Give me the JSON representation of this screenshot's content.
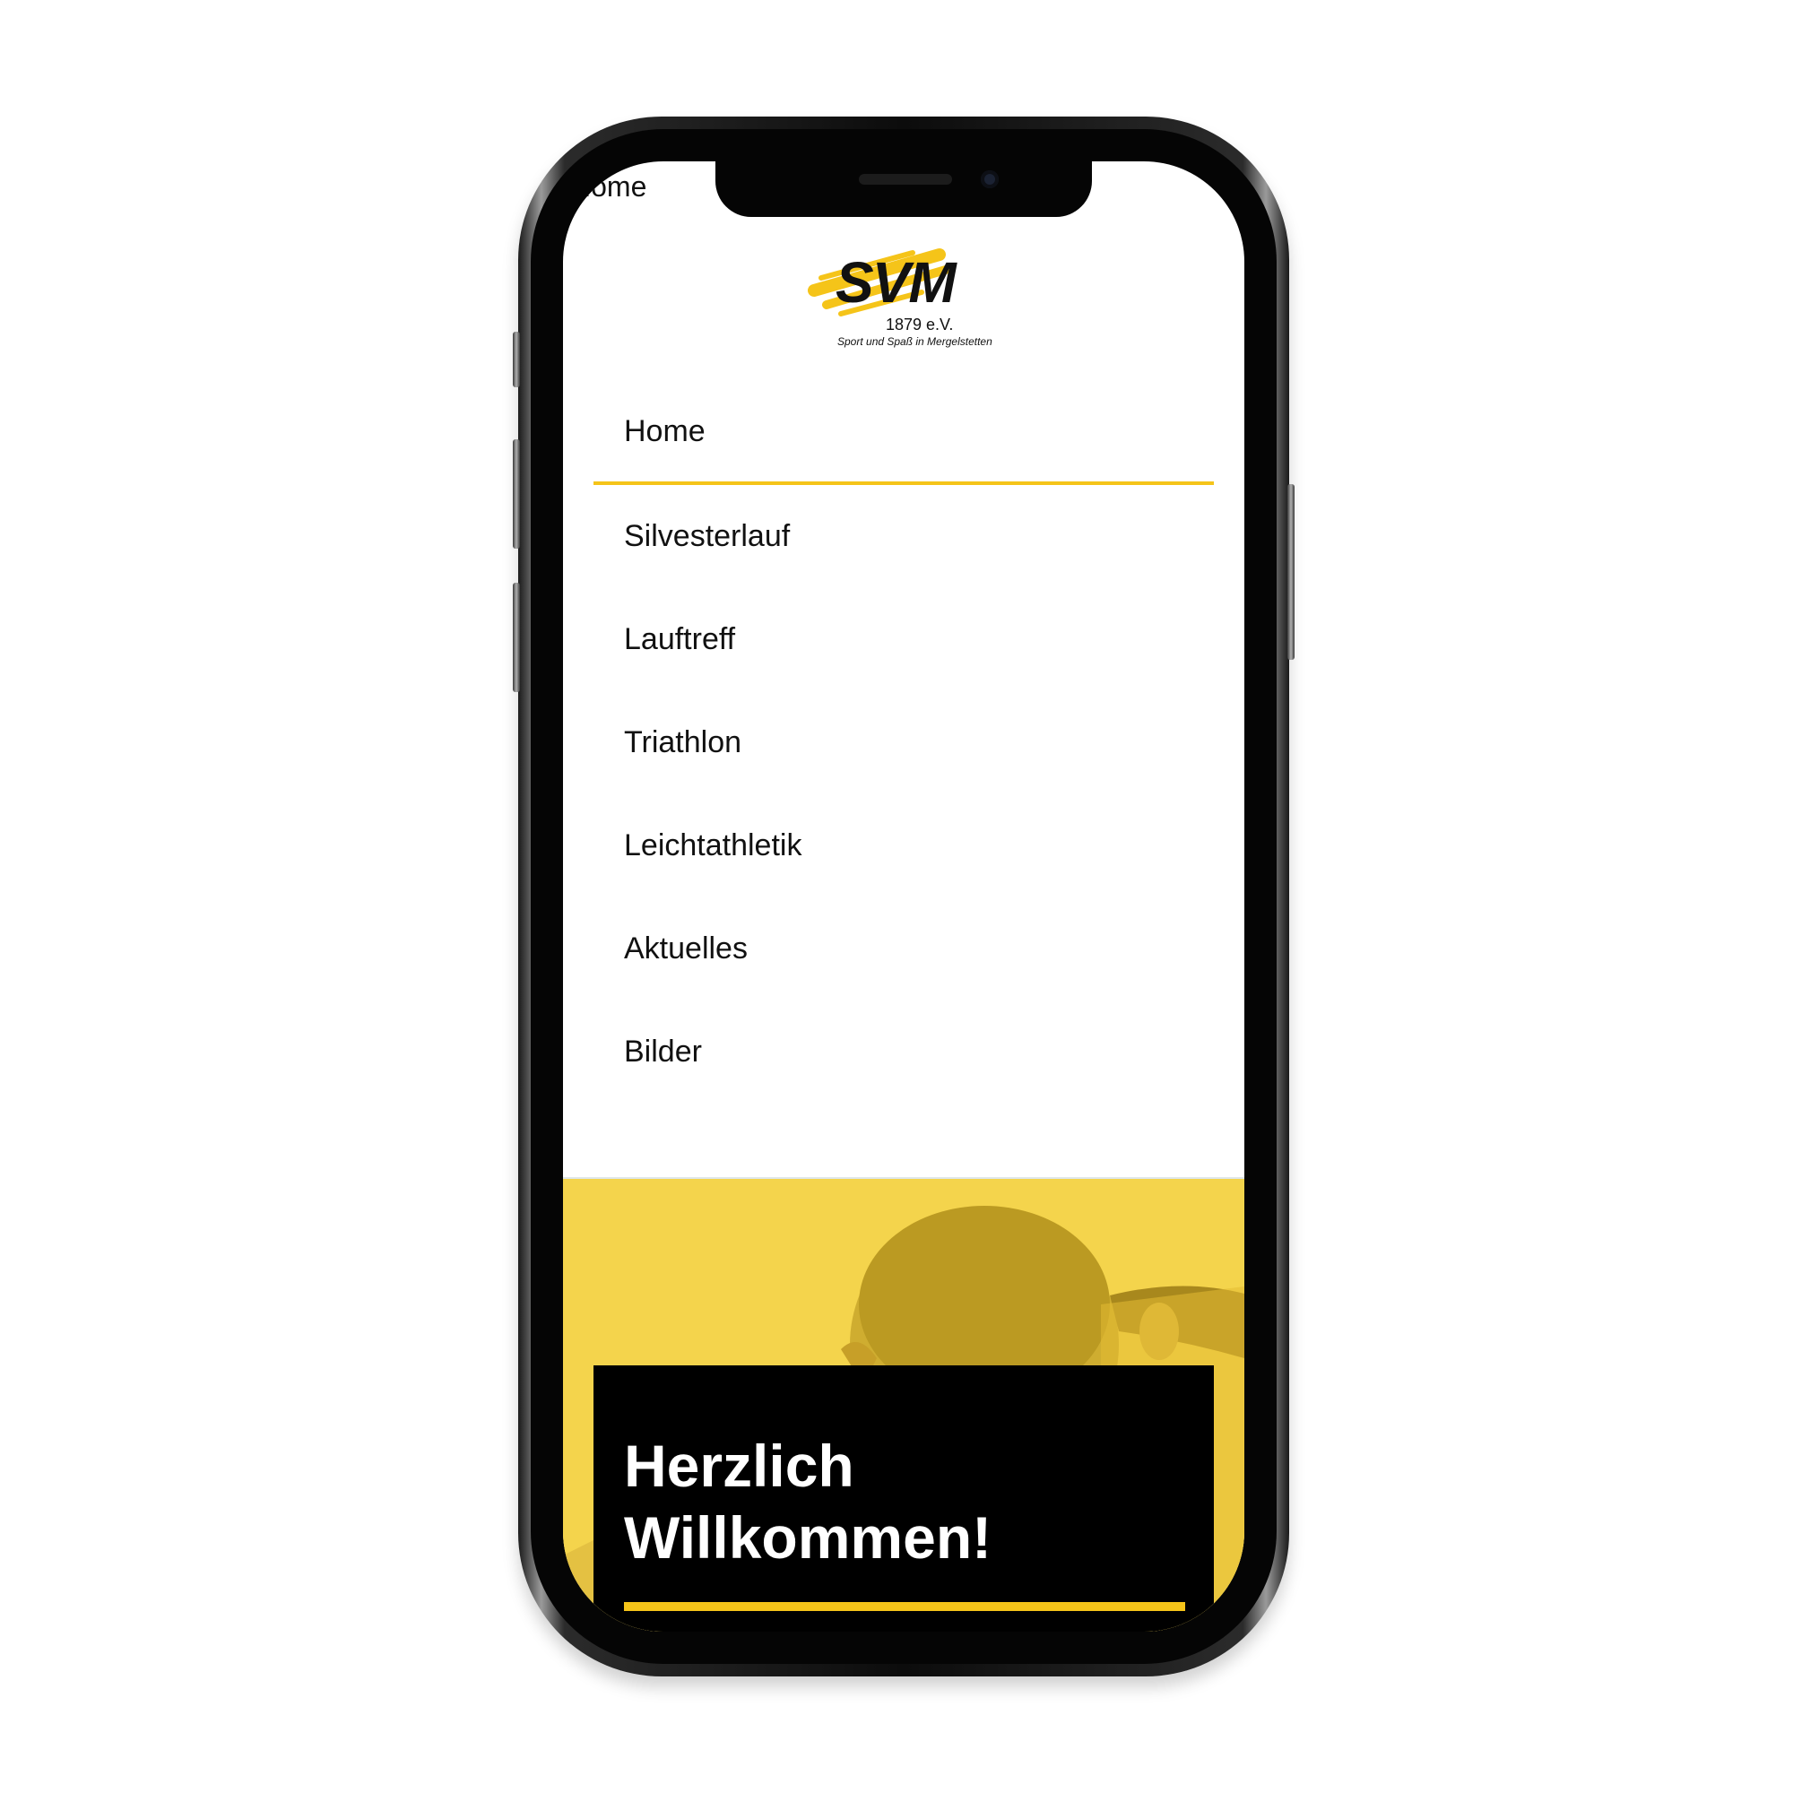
{
  "status_bar": {
    "text": "Home"
  },
  "logo": {
    "wordmark": "SVM",
    "year": "1879 e.V.",
    "tagline": "Sport und Spaß in Mergelstetten",
    "accent_color": "#f5c419"
  },
  "nav": {
    "items": [
      {
        "label": "Home",
        "active": true
      },
      {
        "label": "Silvesterlauf",
        "active": false
      },
      {
        "label": "Lauftreff",
        "active": false
      },
      {
        "label": "Triathlon",
        "active": false
      },
      {
        "label": "Leichtathletik",
        "active": false
      },
      {
        "label": "Aktuelles",
        "active": false
      },
      {
        "label": "Bilder",
        "active": false
      }
    ]
  },
  "hero": {
    "title_line1": "Herzlich",
    "title_line2": "Willkommen!",
    "background_color": "#f4d44c",
    "card_color": "#000000"
  },
  "colors": {
    "accent": "#f5c419",
    "text": "#111111",
    "background": "#ffffff"
  }
}
